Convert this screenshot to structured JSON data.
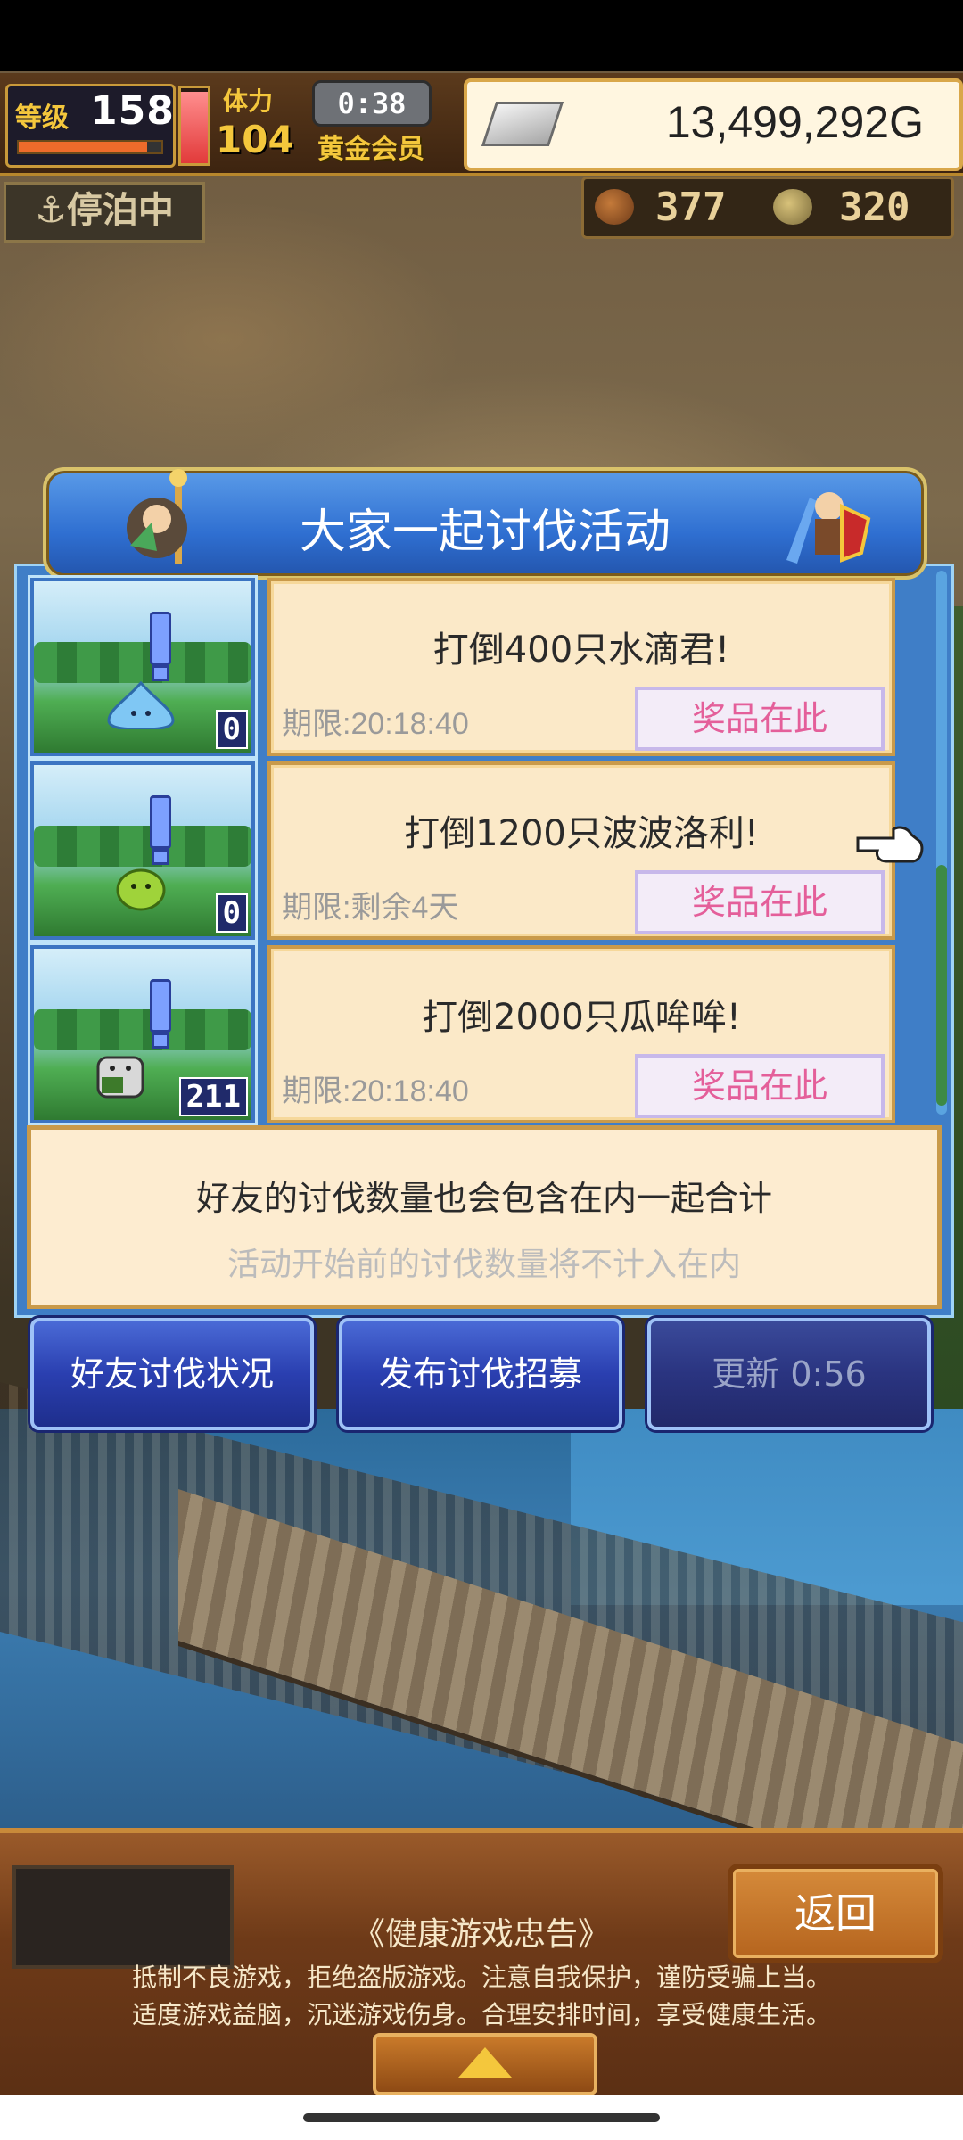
{
  "hud": {
    "level_label": "等级",
    "level": "158",
    "level_progress": 0.9,
    "hp_fraction": 0.95,
    "stamina_label": "体力",
    "stamina": "104",
    "timer": "0:38",
    "membership": "黄金会员",
    "gold": "13,499,292G",
    "status": "停泊中",
    "resource_1": "377",
    "resource_2": "320"
  },
  "event": {
    "title": "大家一起讨伐活动",
    "quests": [
      {
        "title": "打倒400只水滴君!",
        "deadline": "期限:20:18:40",
        "prize": "奖品在此",
        "count": "0"
      },
      {
        "title": "打倒1200只波波洛利!",
        "deadline": "期限:剩余4天",
        "prize": "奖品在此",
        "count": "0"
      },
      {
        "title": "打倒2000只瓜哞哞!",
        "deadline": "期限:20:18:40",
        "prize": "奖品在此",
        "count": "211"
      }
    ],
    "notice_main": "好友的讨伐数量也会包含在内一起合计",
    "notice_sub": "活动开始前的讨伐数量将不计入在内"
  },
  "buttons": {
    "friend_status": "好友讨伐状况",
    "post_recruit": "发布讨伐招募",
    "refresh": "更新 0:56"
  },
  "footer": {
    "back": "返回",
    "advice_title": "《健康游戏忠告》",
    "advice_line1": "抵制不良游戏，拒绝盗版游戏。注意自我保护，谨防受骗上当。",
    "advice_line2": "适度游戏益脑，沉迷游戏伤身。合理安排时间，享受健康生活。"
  },
  "colors": {
    "accent_gold": "#f4c73c",
    "prize_pink": "#e45f9a",
    "panel_blue": "#3f7ec7"
  }
}
